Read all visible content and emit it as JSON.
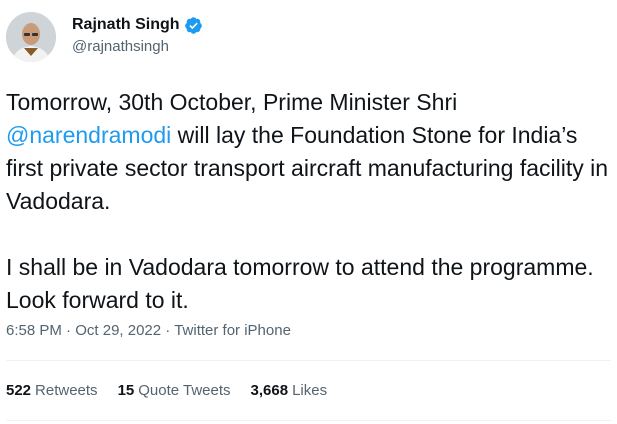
{
  "author": {
    "display_name": "Rajnath Singh",
    "handle": "@rajnathsingh",
    "verified_icon": "verified-badge-icon",
    "avatar_icon": "profile-photo"
  },
  "tweet": {
    "para1_pre": "Tomorrow, 30th October, Prime Minister Shri ",
    "mention": "@narendramodi",
    "para1_post": " will lay the Foundation Stone for India’s first private sector transport aircraft manufacturing facility in Vadodara.",
    "para2": "I shall be in Vadodara tomorrow to attend the programme. Look forward to it."
  },
  "meta": {
    "time": "6:58 PM",
    "separator": " · ",
    "date": "Oct 29, 2022",
    "source": "Twitter for iPhone"
  },
  "stats": {
    "retweets_count": "522",
    "retweets_label": "Retweets",
    "quotes_count": "15",
    "quotes_label": "Quote Tweets",
    "likes_count": "3,668",
    "likes_label": "Likes"
  },
  "colors": {
    "link": "#1d9bf0",
    "text": "#0f1419",
    "secondary": "#536471"
  }
}
